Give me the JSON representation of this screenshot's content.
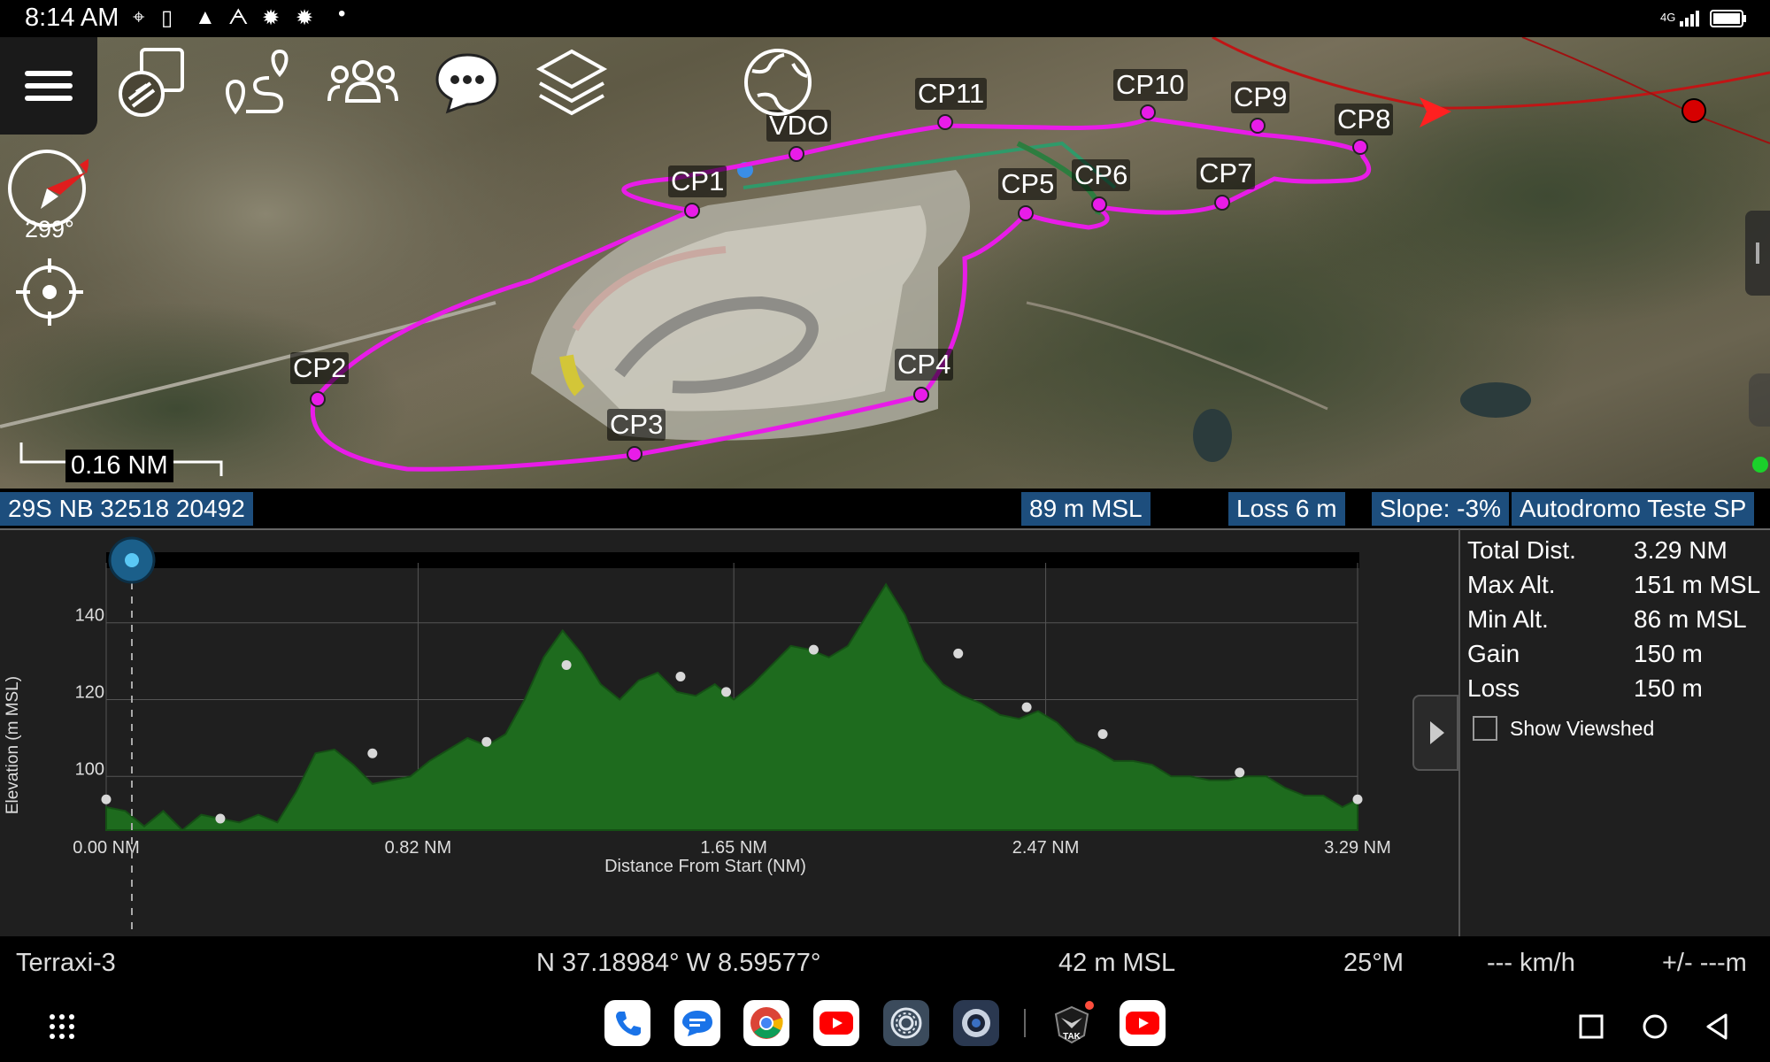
{
  "status_bar": {
    "time": "8:14 AM",
    "network": "4G"
  },
  "map": {
    "heading_degrees": "299°",
    "scale_label": "0.16 NM",
    "checkpoints": [
      {
        "id": "vdo",
        "label": "VDO"
      },
      {
        "id": "cp1",
        "label": "CP1"
      },
      {
        "id": "cp2",
        "label": "CP2"
      },
      {
        "id": "cp3",
        "label": "CP3"
      },
      {
        "id": "cp4",
        "label": "CP4"
      },
      {
        "id": "cp5",
        "label": "CP5"
      },
      {
        "id": "cp6",
        "label": "CP6"
      },
      {
        "id": "cp7",
        "label": "CP7"
      },
      {
        "id": "cp8",
        "label": "CP8"
      },
      {
        "id": "cp9",
        "label": "CP9"
      },
      {
        "id": "cp10",
        "label": "CP10"
      },
      {
        "id": "cp11",
        "label": "CP11"
      }
    ],
    "route_color": "#e81ce8",
    "icons": [
      "menu-icon",
      "drawing-tools-icon",
      "route-icon",
      "contacts-icon",
      "chat-icon",
      "layers-icon",
      "globe-icon",
      "compass-icon",
      "gps-locate-icon"
    ]
  },
  "info_strip": {
    "mgrs": "29S NB 32518 20492",
    "altitude": "89 m MSL",
    "loss": "Loss 6 m",
    "slope": "Slope: -3%",
    "route_name": "Autodromo Teste SP"
  },
  "profile_stats": {
    "rows": [
      {
        "label": "Total Dist.",
        "value": "3.29 NM"
      },
      {
        "label": "Max Alt.",
        "value": "151 m MSL"
      },
      {
        "label": "Min Alt.",
        "value": "86 m MSL"
      },
      {
        "label": "Gain",
        "value": "150 m"
      },
      {
        "label": "Loss",
        "value": "150 m"
      }
    ],
    "show_viewshed_label": "Show Viewshed",
    "show_viewshed_checked": false
  },
  "chart_data": {
    "type": "area",
    "xlabel": "Distance From Start (NM)",
    "ylabel": "Elevation (m MSL)",
    "xlim": [
      0,
      3.29
    ],
    "ylim": [
      86,
      151
    ],
    "x_ticks": [
      {
        "value": 0,
        "label": "0.00 NM"
      },
      {
        "value": 0.82,
        "label": "0.82 NM"
      },
      {
        "value": 1.65,
        "label": "1.65 NM"
      },
      {
        "value": 2.47,
        "label": "2.47 NM"
      },
      {
        "value": 3.29,
        "label": "3.29 NM"
      }
    ],
    "y_ticks": [
      {
        "value": 100,
        "label": "100"
      },
      {
        "value": 120,
        "label": "120"
      },
      {
        "value": 140,
        "label": "140"
      }
    ],
    "grid": true,
    "fill_color": "#1e6b1e",
    "line_color": "#154f15",
    "series": [
      {
        "x": [
          0,
          0.05,
          0.1,
          0.15,
          0.2,
          0.25,
          0.3,
          0.35,
          0.4,
          0.45,
          0.5,
          0.55,
          0.6,
          0.65,
          0.7,
          0.75,
          0.8,
          0.85,
          0.9,
          0.95,
          1.0,
          1.05,
          1.1,
          1.15,
          1.2,
          1.25,
          1.3,
          1.35,
          1.4,
          1.45,
          1.5,
          1.55,
          1.6,
          1.65,
          1.7,
          1.75,
          1.8,
          1.85,
          1.9,
          1.95,
          2.0,
          2.05,
          2.1,
          2.15,
          2.2,
          2.25,
          2.3,
          2.35,
          2.4,
          2.45,
          2.5,
          2.55,
          2.6,
          2.65,
          2.7,
          2.75,
          2.8,
          2.85,
          2.9,
          2.95,
          3.0,
          3.05,
          3.1,
          3.15,
          3.2,
          3.25,
          3.29
        ],
        "y": [
          92,
          91,
          87,
          91,
          86,
          90,
          89,
          88,
          90,
          88,
          96,
          106,
          107,
          103,
          98,
          99,
          100,
          104,
          107,
          110,
          108,
          111,
          120,
          131,
          138,
          132,
          124,
          120,
          125,
          127,
          122,
          121,
          124,
          120,
          124,
          129,
          134,
          133,
          131,
          134,
          142,
          150,
          142,
          130,
          124,
          121,
          119,
          116,
          115,
          117,
          114,
          109,
          107,
          104,
          104,
          103,
          100,
          100,
          99,
          99,
          100,
          100,
          97,
          95,
          95,
          92,
          94
        ]
      }
    ],
    "markers": [
      {
        "x": 0.0,
        "y": 94
      },
      {
        "x": 0.3,
        "y": 89
      },
      {
        "x": 0.7,
        "y": 106
      },
      {
        "x": 1.0,
        "y": 109
      },
      {
        "x": 1.21,
        "y": 129
      },
      {
        "x": 1.51,
        "y": 126
      },
      {
        "x": 1.63,
        "y": 122
      },
      {
        "x": 1.86,
        "y": 133
      },
      {
        "x": 2.24,
        "y": 132
      },
      {
        "x": 2.42,
        "y": 118
      },
      {
        "x": 2.62,
        "y": 111
      },
      {
        "x": 2.98,
        "y": 101
      },
      {
        "x": 3.29,
        "y": 94
      }
    ]
  },
  "bottom_status": {
    "callsign": "Terraxi-3",
    "coords": "N 37.18984°  W 8.59577°",
    "altitude": "42 m MSL",
    "heading": "25°M",
    "speed": "--- km/h",
    "accuracy": "+/- ---m"
  },
  "navbar": {
    "apps": [
      "phone-app-icon",
      "messages-app-icon",
      "chrome-app-icon",
      "youtube-app-icon",
      "settings-app-icon",
      "camera-app-icon",
      "atak-app-icon",
      "youtube-app-icon-2"
    ]
  }
}
